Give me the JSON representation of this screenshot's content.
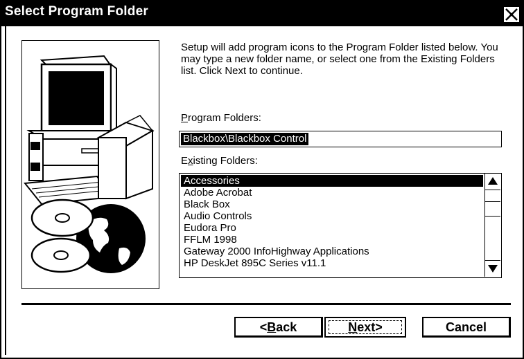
{
  "window": {
    "title": "Select Program Folder"
  },
  "description": "Setup will add program icons to the Program Folder listed below. You may type a new folder name, or select one from the Existing Folders list. Click Next to continue.",
  "program_folders": {
    "label_underlined": "P",
    "label_rest": "rogram Folders:",
    "value": "Blackbox\\Blackbox Control"
  },
  "existing_folders": {
    "label_first": "E",
    "label_underlined": "x",
    "label_rest": "isting Folders:",
    "items": [
      "Accessories",
      "Adobe Acrobat",
      "Black Box",
      "Audio Controls",
      "Eudora Pro",
      "FFLM 1998",
      "Gateway 2000 InfoHighway Applications",
      "HP DeskJet 895C Series v11.1"
    ],
    "selected_index": 0
  },
  "buttons": {
    "back_prefix": "<",
    "back_underlined": "B",
    "back_rest": "ack",
    "next_underlined": "N",
    "next_rest": "ext>",
    "cancel": "Cancel"
  },
  "icons": {
    "close": "close-icon",
    "illustration": "computer-with-cds-and-globe-illustration",
    "scroll_up": "arrow-up-icon",
    "scroll_down": "arrow-down-icon"
  }
}
